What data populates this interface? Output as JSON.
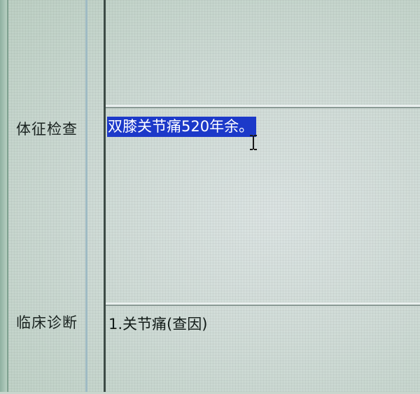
{
  "form": {
    "physical_exam": {
      "label": "体征检查",
      "value": "双膝关节痛520年余。",
      "selected": true
    },
    "clinical_diagnosis": {
      "label": "临床诊断",
      "value": "1.关节痛(查因)"
    }
  },
  "cursor": {
    "icon": "i-beam-cursor-icon"
  },
  "colors": {
    "selection_bg": "#1c39c9",
    "selection_text": "#ffffff",
    "window_bg": "#c9d6cd",
    "text": "#111a17"
  }
}
